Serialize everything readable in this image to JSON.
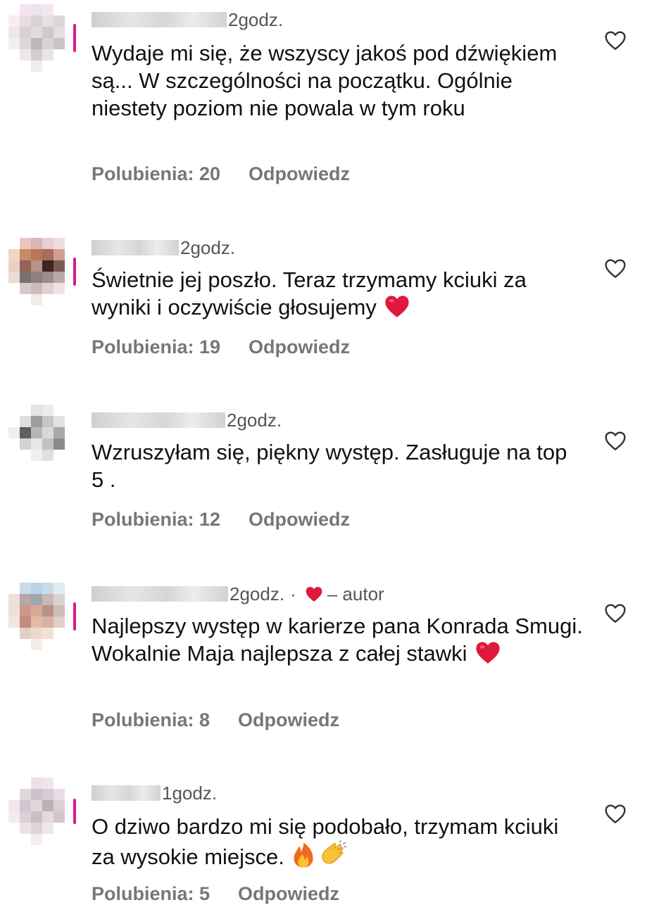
{
  "comments": [
    {
      "time": "2godz.",
      "text": "Wydaje mi się, że wszyscy jakoś pod dźwiękiem są... W szczególności na początku. Ogólnie niestety poziom nie powala w tym roku",
      "likes": "Polubienia: 20",
      "reply": "Odpowiedz",
      "emoji": []
    },
    {
      "time": "2godz.",
      "text": "Świetnie jej poszło. Teraz trzymamy kciuki za wyniki i oczywiście głosujemy",
      "likes": "Polubienia: 19",
      "reply": "Odpowiedz",
      "emoji": [
        "red-heart-emoji"
      ]
    },
    {
      "time": "2godz.",
      "text": "Wzruszyłam się, piękny występ. Zasługuje na top 5 .",
      "likes": "Polubienia: 12",
      "reply": "Odpowiedz",
      "emoji": []
    },
    {
      "time": "2godz.",
      "meta_author": "– autor",
      "text": "Najlepszy występ w karierze pana Konrada Smugi. Wokalnie Maja najlepsza z całej stawki",
      "likes": "Polubienia: 8",
      "reply": "Odpowiedz",
      "emoji": [
        "red-heart-emoji"
      ]
    },
    {
      "time": "1godz.",
      "text": "O dziwo bardzo mi się podobało, trzymam kciuki za wysokie miejsce.",
      "likes": "Polubienia: 5",
      "reply": "Odpowiedz",
      "emoji": [
        "fire-emoji",
        "clapping-hands-emoji"
      ]
    }
  ],
  "colors": {
    "text": "#111111",
    "meta": "#555555",
    "actions": "#777777",
    "heart_red": "#e0183c",
    "avatar_ring": "#d91c8a"
  },
  "icons": {
    "like": "heart-outline-icon",
    "author_liked": "heart-filled-icon"
  }
}
